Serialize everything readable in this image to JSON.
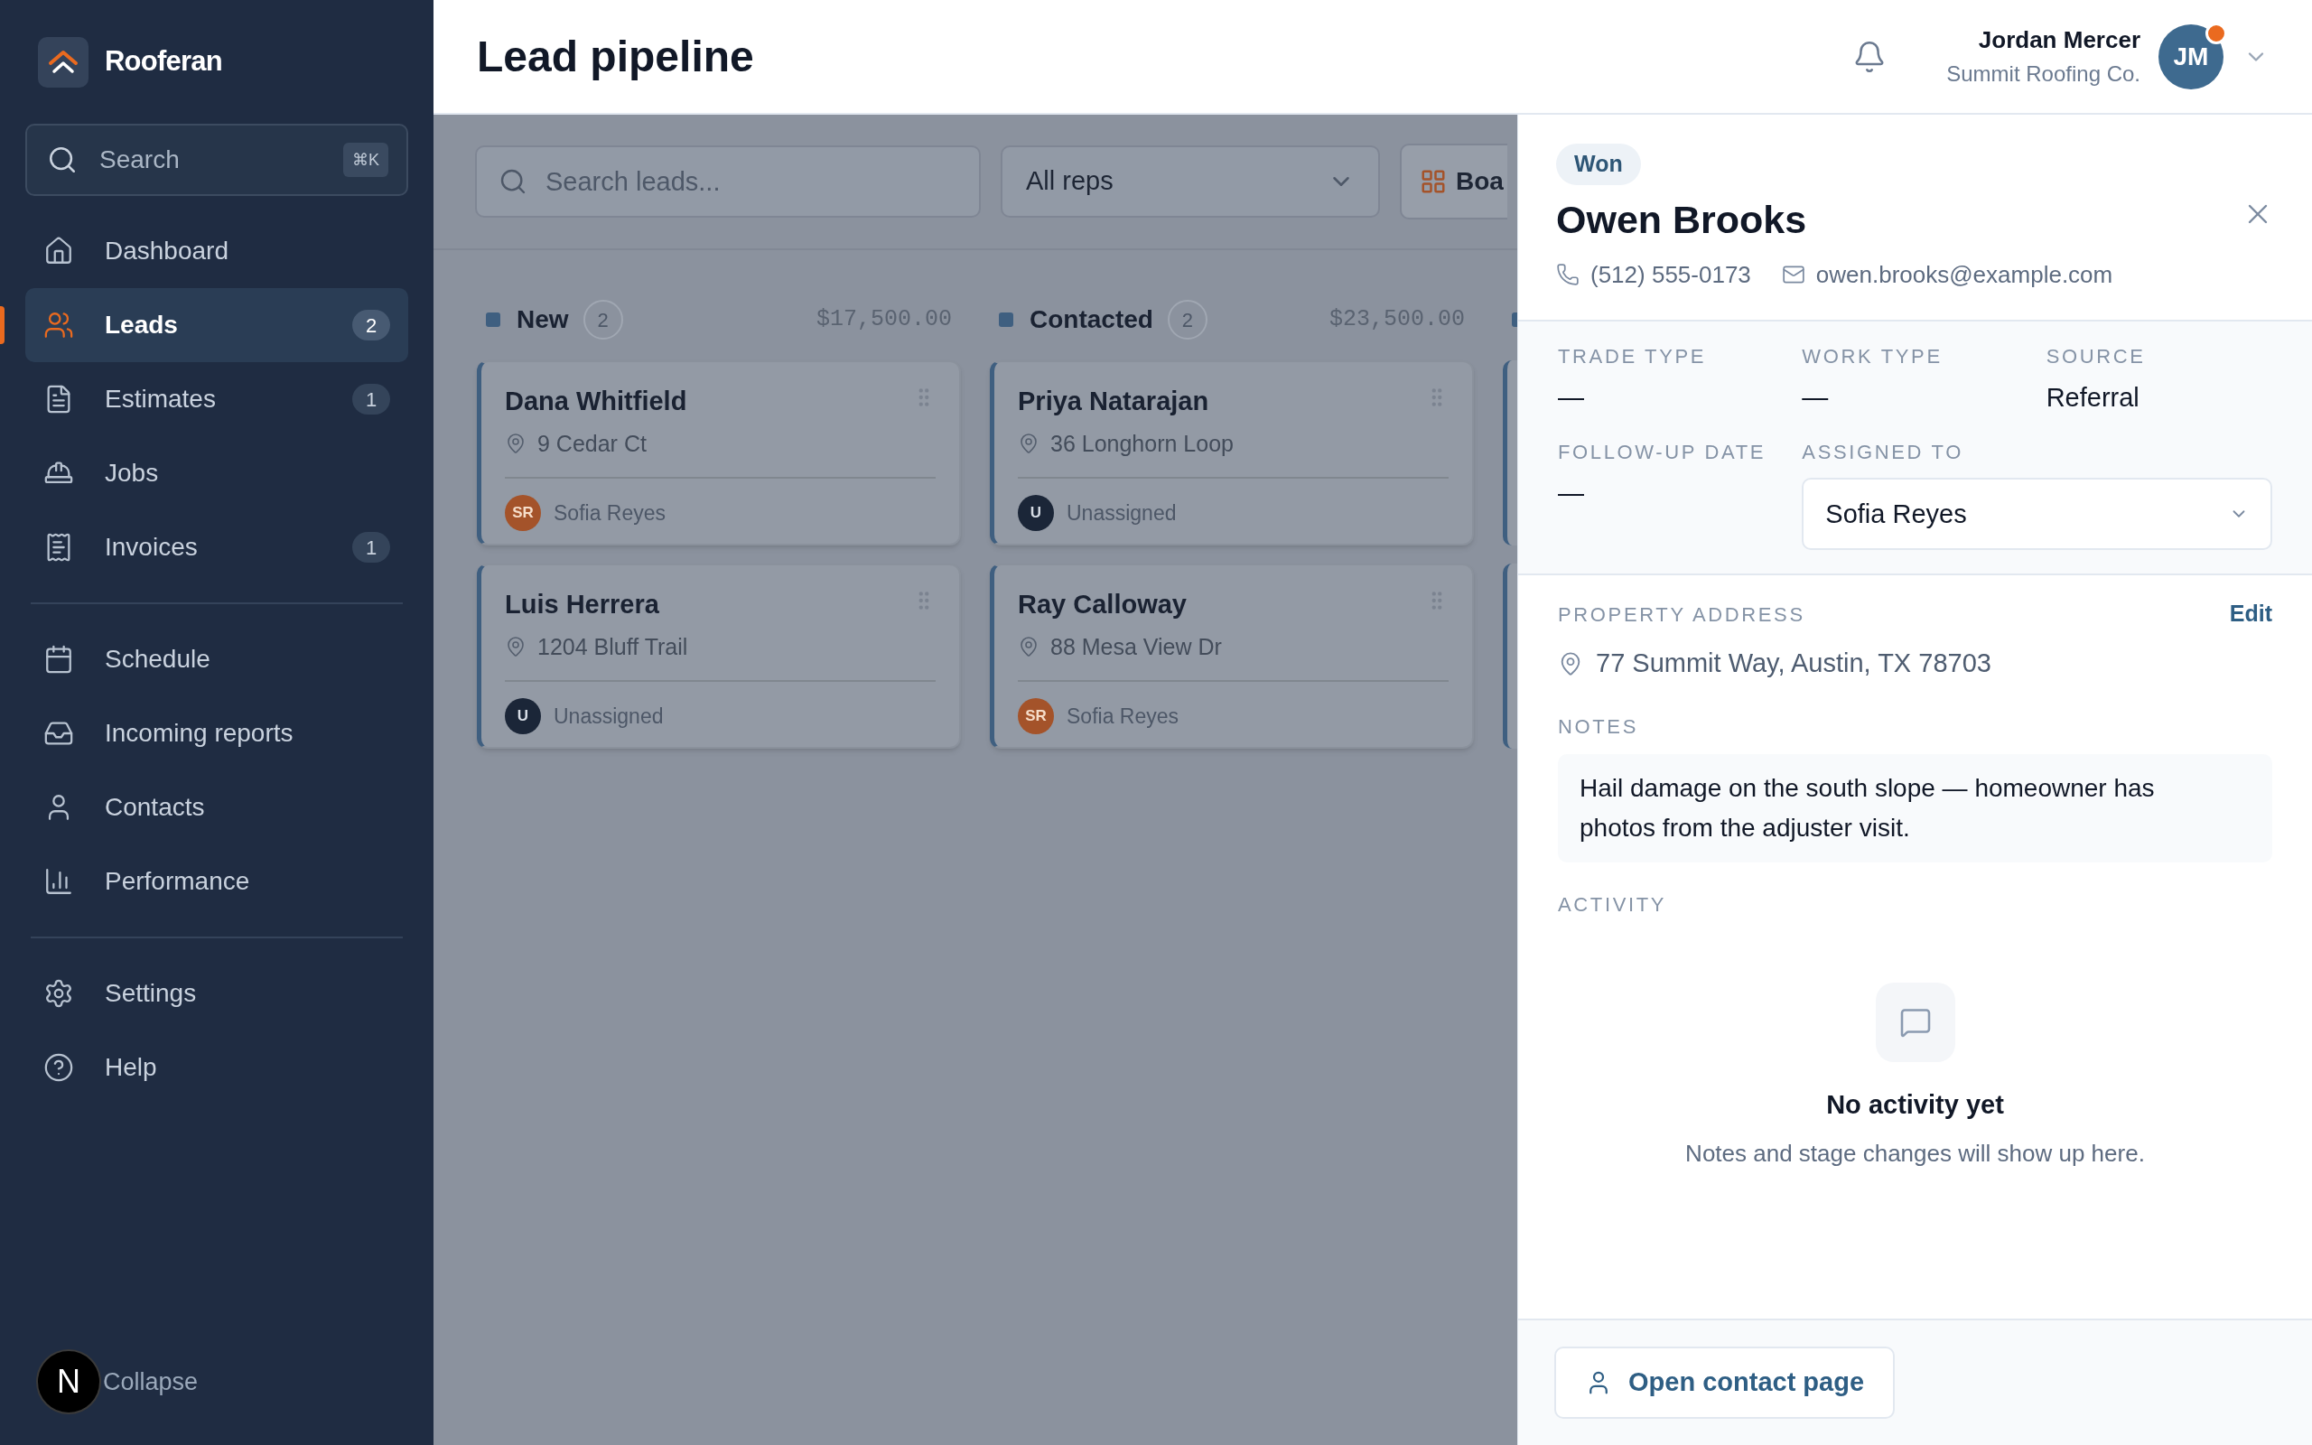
{
  "brand": {
    "name": "Rooferan"
  },
  "sidebar": {
    "search": {
      "placeholder": "Search",
      "shortcut": "⌘K"
    },
    "groups": [
      [
        {
          "label": "Dashboard",
          "selected": false
        },
        {
          "label": "Leads",
          "badge": "2",
          "selected": true
        },
        {
          "label": "Estimates",
          "badge": "1",
          "selected": false
        },
        {
          "label": "Jobs",
          "selected": false
        },
        {
          "label": "Invoices",
          "badge": "1",
          "selected": false
        }
      ],
      [
        {
          "label": "Schedule",
          "selected": false
        },
        {
          "label": "Incoming reports",
          "selected": false
        },
        {
          "label": "Contacts",
          "selected": false
        },
        {
          "label": "Performance",
          "selected": false
        }
      ],
      [
        {
          "label": "Settings",
          "selected": false
        },
        {
          "label": "Help",
          "selected": false
        }
      ]
    ],
    "collapse": "Collapse"
  },
  "dev_badge": {
    "letter": "N"
  },
  "header": {
    "title": "Lead pipeline",
    "user": {
      "name": "Jordan Mercer",
      "company": "Summit Roofing Co.",
      "initials": "JM",
      "notification_dot": true
    }
  },
  "toolbar": {
    "search": {
      "placeholder": "Search leads..."
    },
    "rep_filter": {
      "value": "All reps"
    },
    "view_button": {
      "label": "Boa"
    }
  },
  "columns": [
    {
      "name": "New",
      "count": "2",
      "total": "$17,500.00",
      "color": "#3f5f80",
      "cards": [
        {
          "name": "Dana Whitfield",
          "address": "9 Cedar Ct",
          "assignee": {
            "kind": "rep",
            "initials": "SR",
            "name": "Sofia Reyes"
          }
        },
        {
          "name": "Luis Herrera",
          "address": "1204 Bluff Trail",
          "assignee": {
            "kind": "unassigned",
            "initials": "U",
            "name": "Unassigned"
          }
        }
      ]
    },
    {
      "name": "Contacted",
      "count": "2",
      "total": "$23,500.00",
      "color": "#3f5f80",
      "cards": [
        {
          "name": "Priya Natarajan",
          "address": "36 Longhorn Loop",
          "assignee": {
            "kind": "unassigned",
            "initials": "U",
            "name": "Unassigned"
          }
        },
        {
          "name": "Ray Calloway",
          "address": "88 Mesa View Dr",
          "assignee": {
            "kind": "rep",
            "initials": "SR",
            "name": "Sofia Reyes"
          }
        }
      ]
    },
    {
      "color": "#3f5f80",
      "cards": [
        {
          "kind": "clipped"
        },
        {
          "kind": "clipped"
        }
      ]
    }
  ],
  "detail": {
    "stage": "Won",
    "name": "Owen Brooks",
    "phone": "(512) 555-0173",
    "email": "owen.brooks@example.com",
    "fields": [
      {
        "label": "TRADE TYPE",
        "value": "—"
      },
      {
        "label": "WORK TYPE",
        "value": "—"
      },
      {
        "label": "SOURCE",
        "value": "Referral"
      },
      {
        "label": "FOLLOW-UP DATE",
        "value": "—"
      },
      {
        "label": "ASSIGNED TO",
        "value": "Sofia Reyes",
        "kind": "select"
      }
    ],
    "address": {
      "label": "PROPERTY ADDRESS",
      "action": "Edit",
      "value": "77 Summit Way, Austin, TX 78703"
    },
    "notes": {
      "label": "NOTES",
      "text": "Hail damage on the south slope — homeowner has photos from the adjuster visit."
    },
    "activity": {
      "label": "ACTIVITY",
      "empty_title": "No activity yet",
      "empty_text": "Notes and stage changes will show up here."
    },
    "footer_button": "Open contact page"
  }
}
